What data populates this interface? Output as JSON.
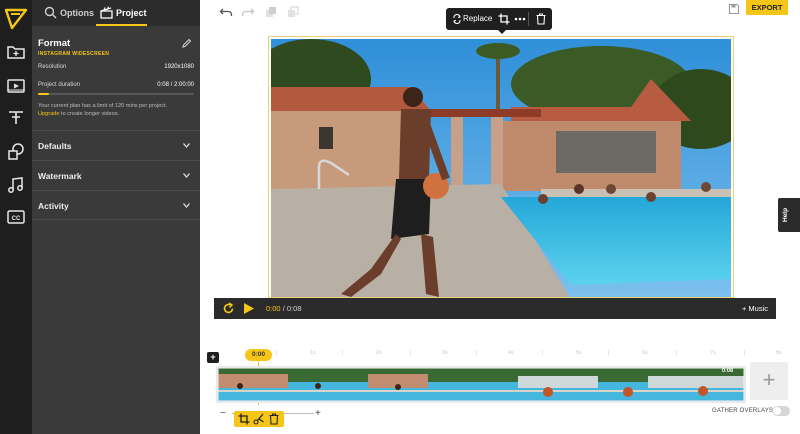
{
  "panel": {
    "tabs": {
      "options": "Options",
      "project": "Project"
    },
    "format": {
      "title": "Format",
      "subtitle": "INSTAGRAM WIDESCREEN"
    },
    "resolution": {
      "label": "Resolution",
      "value": "1920x1080"
    },
    "duration": {
      "label": "Project duration",
      "value": "0:08 / 2:00:00",
      "progress": 0.07
    },
    "plan_note": {
      "text": "Your current plan has a limit of 120 mins per project.",
      "link": "Upgrade",
      "suffix": "to create longer videos."
    },
    "sections": [
      "Defaults",
      "Watermark",
      "Activity"
    ]
  },
  "toolbar": {
    "export_label": "EXPORT"
  },
  "floating_toolbar": {
    "replace_label": "Replace"
  },
  "player": {
    "current_time": "0:00",
    "separator": "/",
    "duration": "0:08",
    "music_label": "+ Music"
  },
  "help": {
    "label": "Help"
  },
  "timeline": {
    "add_label": "+",
    "playhead_time": "0:00",
    "track_duration": "0:08",
    "add_media_label": "+",
    "zoom_out": "−",
    "zoom_in": "+",
    "gather_overlays_label": "GATHER OVERLAYS",
    "gather_overlays_on": false
  },
  "colors": {
    "accent": "#f5c518",
    "rail": "#1e1e1e",
    "panel": "#3a3a3a",
    "dark_ui": "#2b2b2b"
  },
  "icons": {
    "rail": [
      "logo-icon",
      "folder-icon",
      "media-icon",
      "text-icon",
      "shapes-icon",
      "music-icon",
      "captions-icon"
    ],
    "toolbar": [
      "undo-icon",
      "redo-icon",
      "layer-forward-icon",
      "layer-backward-icon",
      "save-icon"
    ],
    "floating": [
      "replace-icon",
      "crop-icon",
      "more-icon",
      "trash-icon"
    ],
    "clip_tools": [
      "crop-icon",
      "split-icon",
      "trash-icon"
    ]
  }
}
